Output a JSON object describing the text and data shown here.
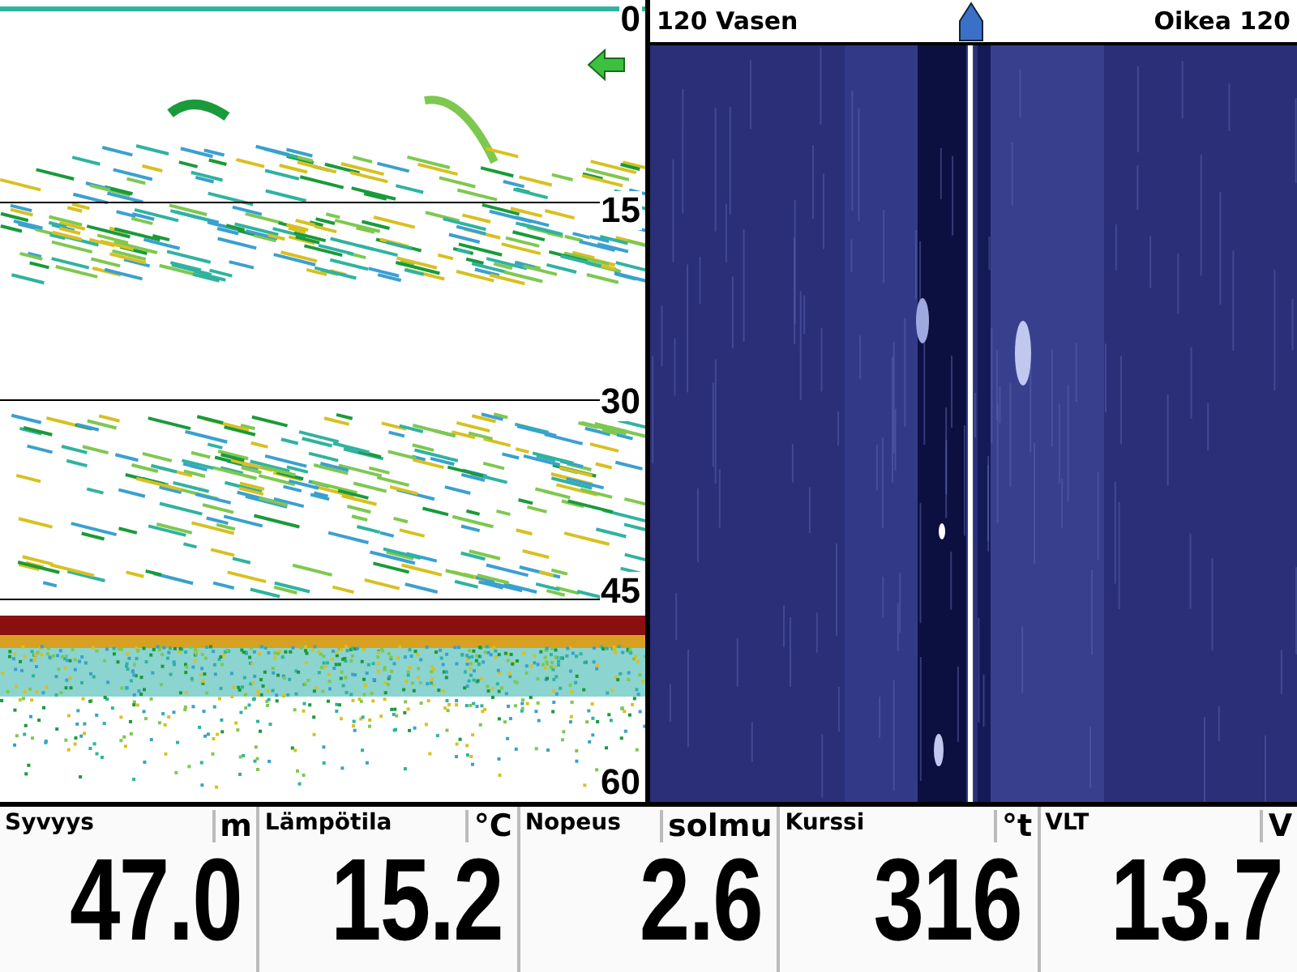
{
  "sonar": {
    "depth_scale": [
      "0",
      "15",
      "30",
      "45",
      "60"
    ]
  },
  "side_imaging": {
    "left_label": "120 Vasen",
    "right_label": "Oikea 120"
  },
  "readouts": [
    {
      "label": "Syvyys",
      "unit": "m",
      "value": "47.0"
    },
    {
      "label": "Lämpötila",
      "unit": "°C",
      "value": "15.2"
    },
    {
      "label": "Nopeus",
      "unit": "solmu",
      "value": "2.6"
    },
    {
      "label": "Kurssi",
      "unit": "°t",
      "value": "316"
    },
    {
      "label": "VLT",
      "unit": "V",
      "value": "13.7"
    }
  ]
}
